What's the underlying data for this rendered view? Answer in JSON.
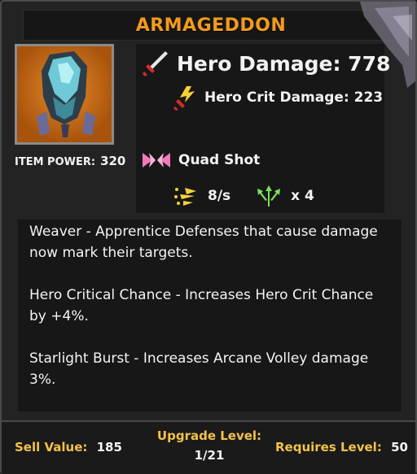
{
  "item": {
    "name": "ARMAGEDDON",
    "item_power_label": "ITEM POWER:",
    "item_power_value": "320"
  },
  "stats": {
    "hero_damage": "Hero Damage: 778",
    "hero_crit_damage": "Hero Crit Damage: 223",
    "projectile_type": "Quad Shot",
    "fire_rate": "8/s",
    "projectile_count": "x 4"
  },
  "perks": [
    "Weaver - Apprentice Defenses that cause damage now mark their targets.",
    "Hero Critical Chance - Increases Hero Crit Chance by +4%.",
    "Starlight Burst - Increases Arcane Volley damage 3%."
  ],
  "footer": {
    "sell_label": "Sell Value:",
    "sell_value": "185",
    "upgrade_label": "Upgrade Level:",
    "upgrade_value": "1/21",
    "requires_label": "Requires Level:",
    "requires_value": "50"
  },
  "colors": {
    "title": "#f39a1d",
    "footer_label": "#f2c24a",
    "portrait_bg": "#c96a12"
  },
  "icons": {
    "damage": "sword-icon",
    "crit": "crit-burst-icon",
    "projectile": "double-arrow-icon",
    "rate": "speed-icon",
    "count": "trident-arrow-icon"
  }
}
